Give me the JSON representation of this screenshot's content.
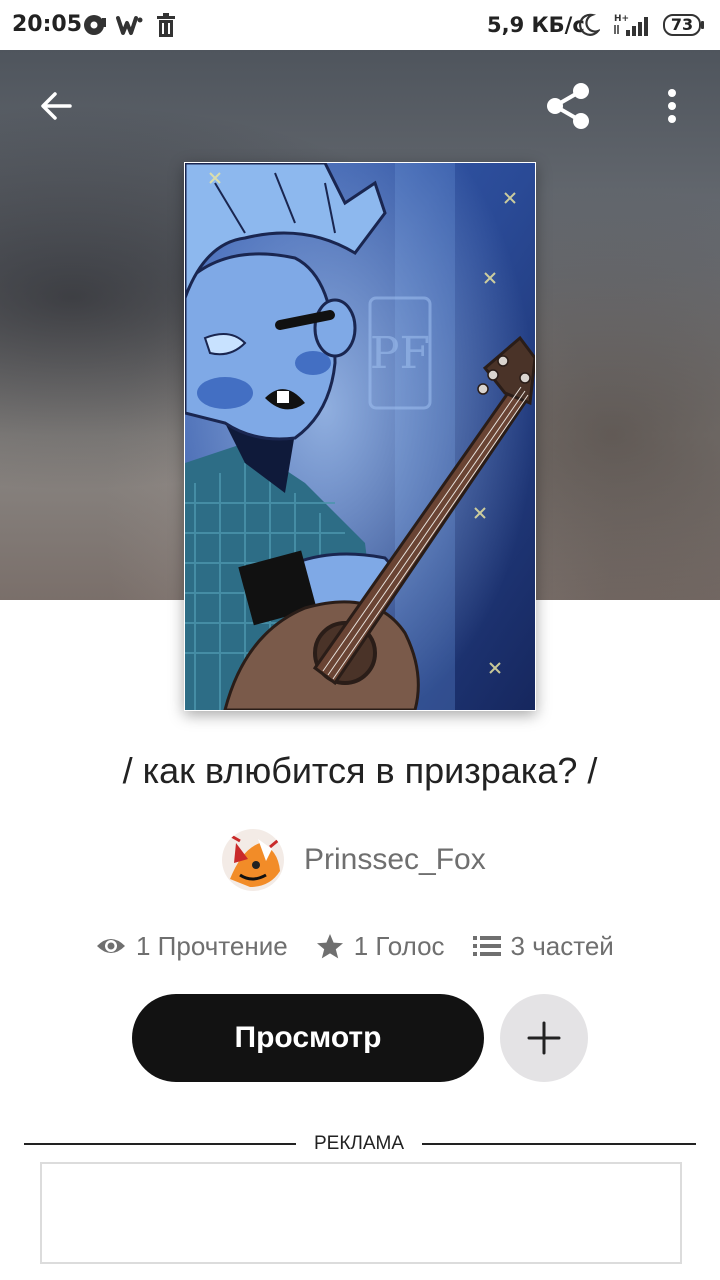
{
  "status_bar": {
    "time": "20:05",
    "network_speed": "5,9 КБ/с",
    "network_type": "H+",
    "battery": "73",
    "icons": [
      "music-app-icon",
      "wattpad-icon",
      "trash-icon",
      "moon-icon",
      "signal-icon",
      "battery-icon"
    ]
  },
  "toolbar": {
    "icons": [
      "back-arrow-icon",
      "share-icon",
      "more-vertical-icon"
    ]
  },
  "cover": {
    "watermark_text": "PF",
    "colors": {
      "background": "#1f3a78",
      "skin": "#7fa9e6",
      "guitar": "#7a5a4a"
    }
  },
  "story": {
    "title": "/ как влюбится в призрака? /",
    "author": "Prinssec_Fox"
  },
  "stats": {
    "reads": "1 Прочтение",
    "votes": "1 Голос",
    "parts": "3 частей",
    "icons": [
      "eye-icon",
      "star-icon",
      "list-icon"
    ]
  },
  "actions": {
    "read_label": "Просмотр",
    "add_icon": "plus-icon"
  },
  "ad": {
    "label": "РЕКЛАМА"
  },
  "colors": {
    "primary_button": "#121212",
    "secondary_button": "#e4e3e5",
    "muted_text": "#6f6f6f",
    "text": "#222222"
  }
}
